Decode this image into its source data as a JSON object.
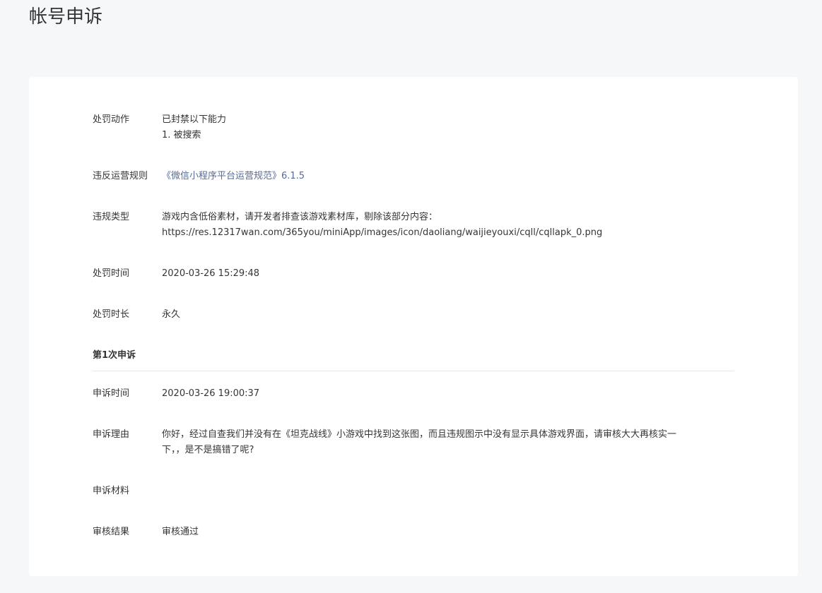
{
  "page": {
    "title": "帐号申诉"
  },
  "penalty": {
    "action_label": "处罚动作",
    "action_line1": "已封禁以下能力",
    "action_line2": "1. 被搜索",
    "rule_label": "违反运营规则",
    "rule_link": "《微信小程序平台运营规范》6.1.5",
    "type_label": "违规类型",
    "type_line1": "游戏内含低俗素材，请开发者排查该游戏素材库，剔除该部分内容：",
    "type_line2": "https://res.12317wan.com/365you/miniApp/images/icon/daoliang/waijieyouxi/cqll/cqllapk_0.png",
    "time_label": "处罚时间",
    "time_value": "2020-03-26 15:29:48",
    "duration_label": "处罚时长",
    "duration_value": "永久"
  },
  "appeal": {
    "section_title": "第1次申诉",
    "time_label": "申诉时间",
    "time_value": "2020-03-26 19:00:37",
    "reason_label": "申诉理由",
    "reason_line1": "你好，经过自查我们并没有在《坦克战线》小游戏中找到这张图，而且违规图示中没有显示具体游戏界面，请审核大大再核实一",
    "reason_line2": "下，，是不是搞错了呢?",
    "material_label": "申诉材料",
    "result_label": "审核结果",
    "result_value": "审核通过"
  }
}
